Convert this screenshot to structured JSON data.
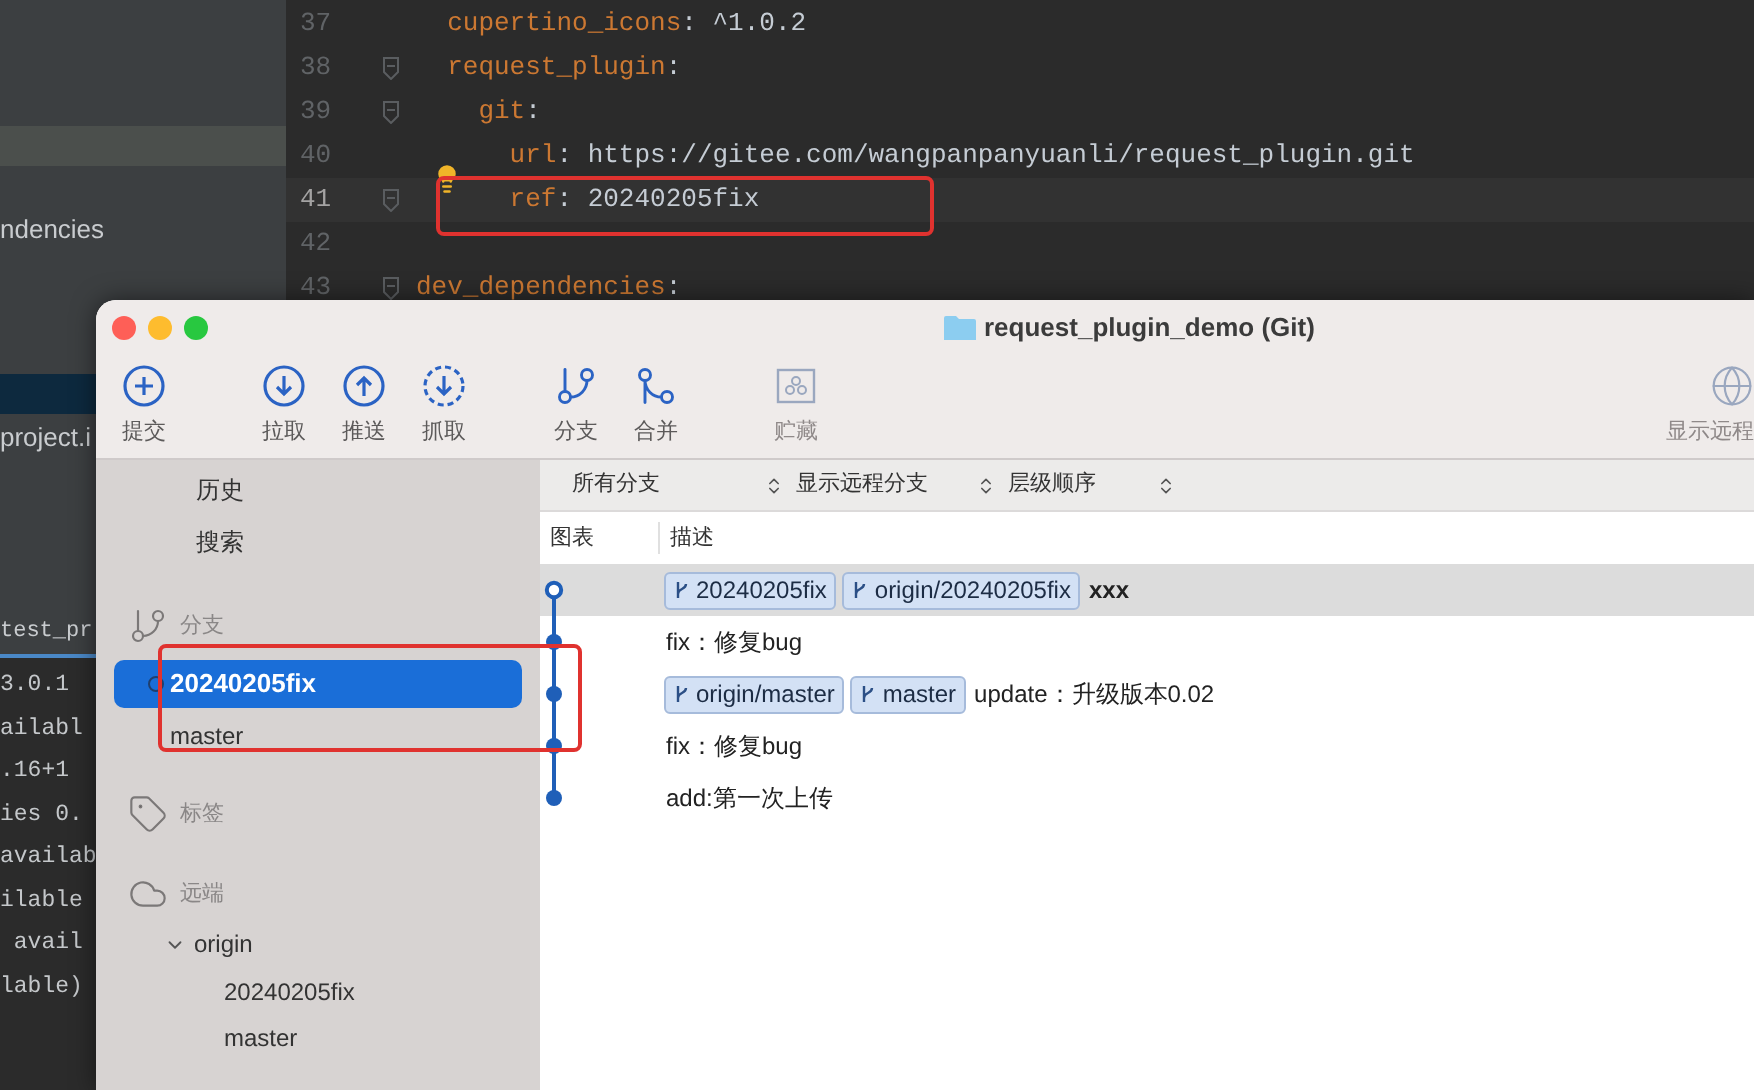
{
  "ide": {
    "project_panel": {
      "items": [
        {
          "label": "ndencies",
          "selected": false
        },
        {
          "label": "project.i",
          "selected": false
        }
      ]
    },
    "editor": {
      "lines": [
        {
          "number": "37",
          "fold": false,
          "current": false,
          "tokens": [
            {
              "kind": "key",
              "text": "  cupertino_icons"
            },
            {
              "kind": "punct",
              "text": ":"
            },
            {
              "kind": "value",
              "text": " ^1.0.2"
            }
          ]
        },
        {
          "number": "38",
          "fold": true,
          "current": false,
          "tokens": [
            {
              "kind": "key",
              "text": "  request_plugin"
            },
            {
              "kind": "punct",
              "text": ":"
            }
          ]
        },
        {
          "number": "39",
          "fold": true,
          "current": false,
          "tokens": [
            {
              "kind": "key",
              "text": "    git"
            },
            {
              "kind": "punct",
              "text": ":"
            }
          ]
        },
        {
          "number": "40",
          "fold": false,
          "current": false,
          "tokens": [
            {
              "kind": "key",
              "text": "      url"
            },
            {
              "kind": "punct",
              "text": ":"
            },
            {
              "kind": "value",
              "text": " https://gitee.com/wangpanpanyuanli/request_plugin.git"
            }
          ]
        },
        {
          "number": "41",
          "fold": true,
          "current": true,
          "tokens": [
            {
              "kind": "key",
              "text": "      ref"
            },
            {
              "kind": "punct",
              "text": ":"
            },
            {
              "kind": "value",
              "text": " 20240205fix"
            }
          ]
        },
        {
          "number": "42",
          "fold": false,
          "current": false
        },
        {
          "number": "43",
          "fold": true,
          "current": false,
          "tokens": [
            {
              "kind": "key",
              "text": "dev_dependencies"
            },
            {
              "kind": "punct",
              "text": ":"
            }
          ]
        }
      ]
    },
    "console": {
      "tab": "test_pr",
      "lines": [
        "3.0.1",
        "ailabl",
        ".16+1",
        "ies 0.",
        "availab",
        "ilable",
        " avail",
        "lable)"
      ]
    }
  },
  "git_window": {
    "title": "request_plugin_demo (Git)",
    "toolbar": [
      {
        "kind": "commit",
        "label": "提交",
        "disabled": false
      },
      {
        "kind": "pull",
        "label": "拉取",
        "disabled": false
      },
      {
        "kind": "push",
        "label": "推送",
        "disabled": false
      },
      {
        "kind": "fetch",
        "label": "抓取",
        "disabled": false
      },
      {
        "kind": "branch",
        "label": "分支",
        "disabled": false
      },
      {
        "kind": "merge",
        "label": "合并",
        "disabled": false
      },
      {
        "kind": "stash",
        "label": "贮藏",
        "disabled": true
      },
      {
        "kind": "remote",
        "label": "显示远程",
        "disabled": true
      }
    ],
    "sidebar": {
      "items": [
        {
          "label": "历史"
        },
        {
          "label": "搜索"
        }
      ],
      "sections": [
        {
          "kind": "branches",
          "title": "分支",
          "items": [
            {
              "label": "20240205fix",
              "selected": true,
              "current": true
            },
            {
              "label": "master",
              "selected": false,
              "current": false
            }
          ]
        },
        {
          "kind": "tags",
          "title": "标签"
        },
        {
          "kind": "remotes",
          "title": "远端",
          "items": [
            {
              "label": "origin",
              "expanded": true,
              "children": [
                {
                  "label": "20240205fix"
                },
                {
                  "label": "master"
                }
              ]
            }
          ]
        }
      ]
    },
    "filters": [
      {
        "label": "所有分支"
      },
      {
        "label": "显示远程分支"
      },
      {
        "label": "层级顺序"
      }
    ],
    "table": {
      "columns": [
        "图表",
        "描述"
      ],
      "rows": [
        {
          "selected": true,
          "head": true,
          "refs": [
            "20240205fix",
            "origin/20240205fix"
          ],
          "message": "xxx"
        },
        {
          "selected": false,
          "head": false,
          "refs": [],
          "message": "fix：修复bug"
        },
        {
          "selected": false,
          "head": false,
          "refs": [
            "origin/master",
            "master"
          ],
          "message": "update：升级版本0.02"
        },
        {
          "selected": false,
          "head": false,
          "refs": [],
          "message": "fix：修复bug"
        },
        {
          "selected": false,
          "head": false,
          "refs": [],
          "message": "add:第一次上传"
        }
      ]
    }
  }
}
